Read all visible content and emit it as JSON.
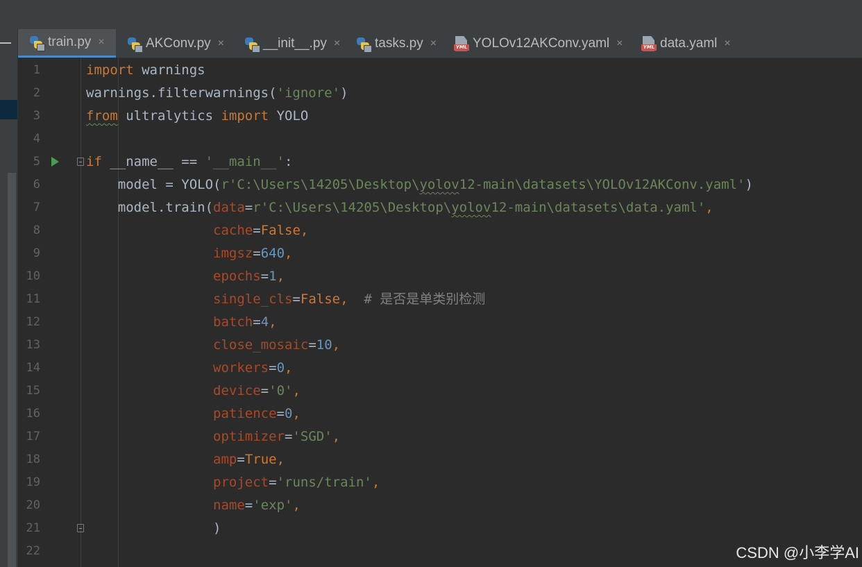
{
  "tabs": [
    {
      "label": "train.py",
      "icon": "python-file-icon",
      "active": true
    },
    {
      "label": "AKConv.py",
      "icon": "python-file-icon"
    },
    {
      "label": "__init__.py",
      "icon": "python-file-icon"
    },
    {
      "label": "tasks.py",
      "icon": "python-file-icon"
    },
    {
      "label": "YOLOv12AKConv.yaml",
      "icon": "yaml-file-icon"
    },
    {
      "label": "data.yaml",
      "icon": "yaml-file-icon"
    }
  ],
  "close_glyph": "×",
  "yml_tag": "YML",
  "lines": [
    [
      {
        "t": "import",
        "c": "kw"
      },
      {
        "t": " warnings"
      }
    ],
    [
      {
        "t": "warnings.filterwarnings("
      },
      {
        "t": "'ignore'",
        "c": "str"
      },
      {
        "t": ")"
      }
    ],
    [
      {
        "t": "from",
        "c": "kw wavy"
      },
      {
        "t": " ultralytics "
      },
      {
        "t": "import",
        "c": "kw"
      },
      {
        "t": " YOLO"
      }
    ],
    [],
    [
      {
        "t": "if",
        "c": "kw"
      },
      {
        "t": " __name__ == "
      },
      {
        "t": "'__main__'",
        "c": "str"
      },
      {
        "t": ":"
      }
    ],
    [
      {
        "t": "    model = YOLO("
      },
      {
        "t": "r'C:\\Users\\14205\\Desktop\\",
        "c": "str"
      },
      {
        "t": "yolov",
        "c": "str wavy"
      },
      {
        "t": "12-main\\datasets\\YOLOv12AKConv.yaml'",
        "c": "str"
      },
      {
        "t": ")"
      }
    ],
    [
      {
        "t": "    model.train("
      },
      {
        "t": "data",
        "c": "param"
      },
      {
        "t": "="
      },
      {
        "t": "r'C:\\Users\\14205\\Desktop\\",
        "c": "str"
      },
      {
        "t": "yolov",
        "c": "str wavy"
      },
      {
        "t": "12-main\\datasets\\data.yaml'",
        "c": "str"
      },
      {
        "t": ",",
        "c": "kw"
      }
    ],
    [
      {
        "t": "                "
      },
      {
        "t": "cache",
        "c": "param"
      },
      {
        "t": "="
      },
      {
        "t": "False",
        "c": "kw"
      },
      {
        "t": ",",
        "c": "kw"
      }
    ],
    [
      {
        "t": "                "
      },
      {
        "t": "imgsz",
        "c": "param"
      },
      {
        "t": "="
      },
      {
        "t": "640",
        "c": "num"
      },
      {
        "t": ",",
        "c": "kw"
      }
    ],
    [
      {
        "t": "                "
      },
      {
        "t": "epochs",
        "c": "param"
      },
      {
        "t": "="
      },
      {
        "t": "1",
        "c": "num"
      },
      {
        "t": ",",
        "c": "kw"
      }
    ],
    [
      {
        "t": "                "
      },
      {
        "t": "single_cls",
        "c": "param"
      },
      {
        "t": "="
      },
      {
        "t": "False",
        "c": "kw"
      },
      {
        "t": ",",
        "c": "kw"
      },
      {
        "t": "  # 是否是单类别检测",
        "c": "cm"
      }
    ],
    [
      {
        "t": "                "
      },
      {
        "t": "batch",
        "c": "param"
      },
      {
        "t": "="
      },
      {
        "t": "4",
        "c": "num"
      },
      {
        "t": ",",
        "c": "kw"
      }
    ],
    [
      {
        "t": "                "
      },
      {
        "t": "close_mosaic",
        "c": "param"
      },
      {
        "t": "="
      },
      {
        "t": "10",
        "c": "num"
      },
      {
        "t": ",",
        "c": "kw"
      }
    ],
    [
      {
        "t": "                "
      },
      {
        "t": "workers",
        "c": "param"
      },
      {
        "t": "="
      },
      {
        "t": "0",
        "c": "num"
      },
      {
        "t": ",",
        "c": "kw"
      }
    ],
    [
      {
        "t": "                "
      },
      {
        "t": "device",
        "c": "param"
      },
      {
        "t": "="
      },
      {
        "t": "'0'",
        "c": "str"
      },
      {
        "t": ",",
        "c": "kw"
      }
    ],
    [
      {
        "t": "                "
      },
      {
        "t": "patience",
        "c": "param"
      },
      {
        "t": "="
      },
      {
        "t": "0",
        "c": "num"
      },
      {
        "t": ",",
        "c": "kw"
      }
    ],
    [
      {
        "t": "                "
      },
      {
        "t": "optimizer",
        "c": "param"
      },
      {
        "t": "="
      },
      {
        "t": "'SGD'",
        "c": "str"
      },
      {
        "t": ",",
        "c": "kw"
      }
    ],
    [
      {
        "t": "                "
      },
      {
        "t": "amp",
        "c": "param"
      },
      {
        "t": "="
      },
      {
        "t": "True",
        "c": "kw"
      },
      {
        "t": ",",
        "c": "kw"
      }
    ],
    [
      {
        "t": "                "
      },
      {
        "t": "project",
        "c": "param"
      },
      {
        "t": "="
      },
      {
        "t": "'runs/train'",
        "c": "str"
      },
      {
        "t": ",",
        "c": "kw"
      }
    ],
    [
      {
        "t": "                "
      },
      {
        "t": "name",
        "c": "param"
      },
      {
        "t": "="
      },
      {
        "t": "'exp'",
        "c": "str"
      },
      {
        "t": ",",
        "c": "kw"
      }
    ],
    [
      {
        "t": "                )"
      }
    ],
    []
  ],
  "run_line": 5,
  "fold_lines": [
    5,
    21
  ],
  "colors": {
    "background": "#2b2b2b",
    "keyword": "#cc7832",
    "string": "#6a8759",
    "number": "#6897bb",
    "parameter": "#aa4926",
    "comment": "#808080",
    "text": "#a9b7c6",
    "line_number": "#606366",
    "active_tab_underline": "#4a88c7",
    "run_icon": "#499c54"
  },
  "watermark": "CSDN @小李学AI"
}
